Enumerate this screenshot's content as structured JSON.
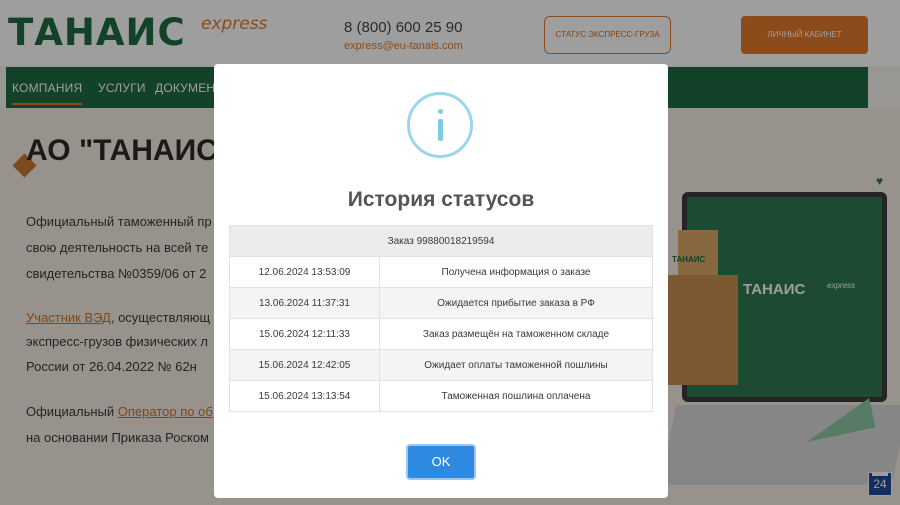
{
  "header": {
    "logo_text": "ТАНАИС",
    "logo_sub": "express",
    "phone": "8 (800) 600 25 90",
    "email": "express@eu-tanais.com",
    "status_button": "СТАТУС ЭКСПРЕСС-ГРУЗА",
    "cabinet_button": "ЛИЧНЫЙ КАБИНЕТ"
  },
  "nav": {
    "items": [
      {
        "label": "КОМПАНИЯ"
      },
      {
        "label": "УСЛУГИ"
      },
      {
        "label": "ДОКУМЕН"
      }
    ]
  },
  "content": {
    "title": "АО \"ТАНАИС",
    "lines": [
      "Официальный таможенный пр",
      "свою деятельность на всей те",
      "свидетельства №0359/06 от 2"
    ],
    "link1": "Участник ВЭД",
    "link1_after": ", осуществляющ",
    "lines2": [
      "экспресс-грузов физических л",
      "России от 26.04.2022 № 62н"
    ],
    "para3_prefix": "Официальный ",
    "link2": "Оператор по об",
    "para3_line2": "на основании Приказа Роском"
  },
  "illustration": {
    "screen_logo": "ТАНАИС",
    "screen_sub": "express",
    "box_label": "ТАНАИС"
  },
  "badge": {
    "label": "24"
  },
  "modal": {
    "title": "История статусов",
    "order_label": "Заказ 99880018219594",
    "rows": [
      {
        "date": "12.06.2024 13:53:09",
        "status": "Получена информация о заказе"
      },
      {
        "date": "13.06.2024 11:37:31",
        "status": "Ожидается прибытие заказа в РФ"
      },
      {
        "date": "15.06.2024 12:11:33",
        "status": "Заказ размещён на таможенном складе"
      },
      {
        "date": "15.06.2024 12:42:05",
        "status": "Ожидает оплаты таможенной пошлины"
      },
      {
        "date": "15.06.2024 13:13:54",
        "status": "Таможенная пошлина оплачена"
      }
    ],
    "ok_label": "OK"
  },
  "colors": {
    "brand_green": "#1e6b42",
    "brand_orange": "#e07a2a",
    "ok_blue": "#2d8ae0",
    "info_icon": "#9ad6ec"
  },
  "icons": {
    "modal_icon": "info-icon"
  }
}
